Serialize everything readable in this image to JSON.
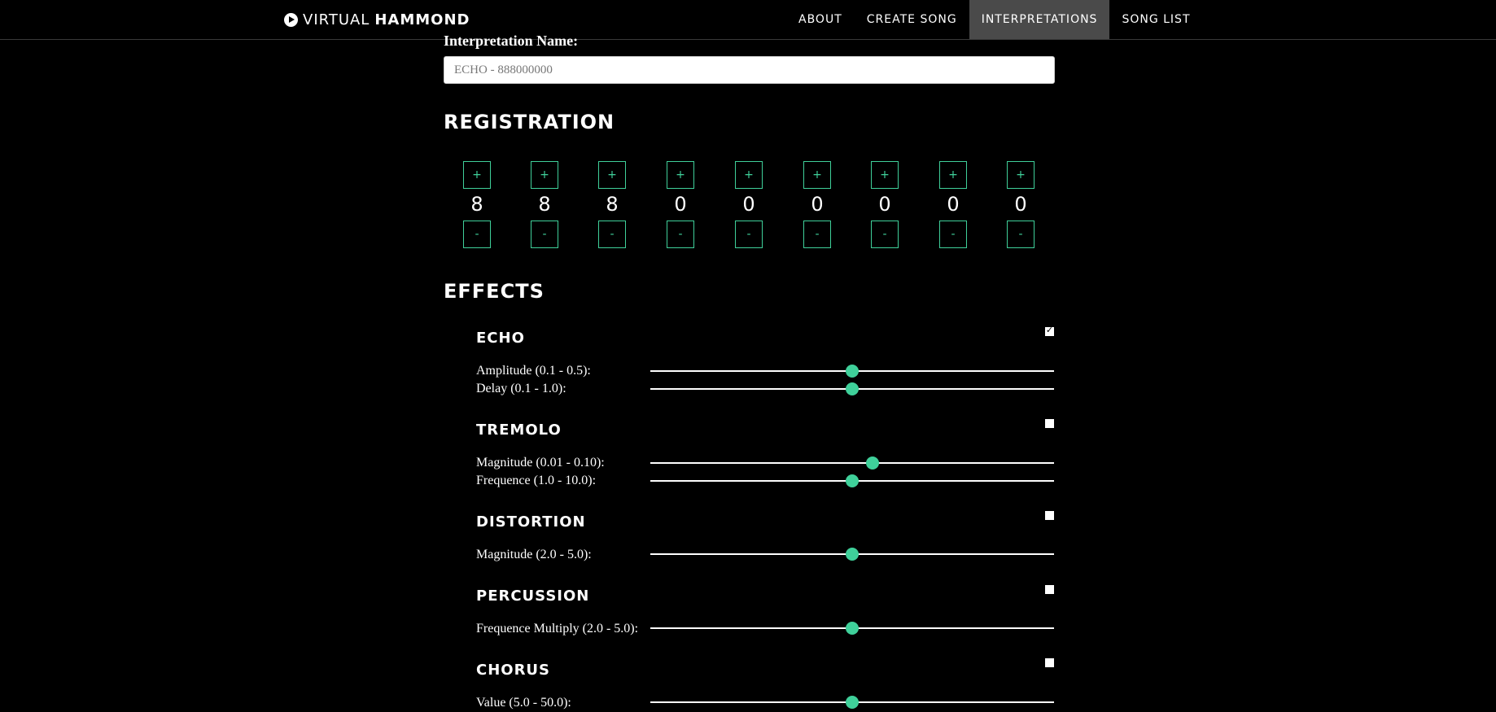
{
  "brand": {
    "prefix": "VIRTUAL",
    "suffix": "HAMMOND"
  },
  "nav": [
    "ABOUT",
    "CREATE SONG",
    "INTERPRETATIONS",
    "SONG LIST"
  ],
  "form": {
    "name_label": "Interpretation Name:",
    "name_placeholder": "ECHO - 888000000",
    "name_value": ""
  },
  "registration": {
    "title": "REGISTRATION",
    "plus": "+",
    "minus": "-",
    "values": [
      "8",
      "8",
      "8",
      "0",
      "0",
      "0",
      "0",
      "0",
      "0"
    ]
  },
  "effects": {
    "title": "EFFECTS",
    "echo": {
      "name": "ECHO",
      "enabled": true,
      "params": [
        {
          "label": "Amplitude (0.1 - 0.5):",
          "level": 0.5
        },
        {
          "label": "Delay (0.1 - 1.0):",
          "level": 0.5
        }
      ]
    },
    "tremolo": {
      "name": "TREMOLO",
      "enabled": false,
      "params": [
        {
          "label": "Magnitude (0.01 - 0.10):",
          "level": 0.55
        },
        {
          "label": "Frequence (1.0 - 10.0):",
          "level": 0.5
        }
      ]
    },
    "distortion": {
      "name": "DISTORTION",
      "enabled": false,
      "params": [
        {
          "label": "Magnitude (2.0 - 5.0):",
          "level": 0.5
        }
      ]
    },
    "percussion": {
      "name": "PERCUSSION",
      "enabled": false,
      "params": [
        {
          "label": "Frequence Multiply (2.0 - 5.0):",
          "level": 0.5
        }
      ]
    },
    "chorus": {
      "name": "CHORUS",
      "enabled": false,
      "params": [
        {
          "label": "Value (5.0 - 50.0):",
          "level": 0.5
        }
      ]
    }
  },
  "colors": {
    "accent": "#3fd09a",
    "active_nav_bg": "#4a4a4a",
    "background": "#000000"
  },
  "icons": {
    "brand": "play-circle-icon"
  }
}
